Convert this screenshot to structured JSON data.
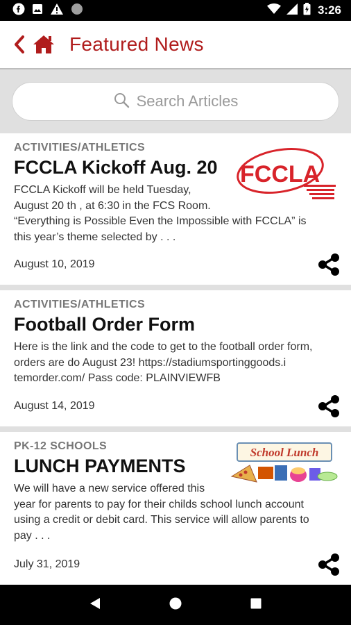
{
  "status_bar": {
    "time": "3:26",
    "left_icons": [
      "fb-icon",
      "image-icon",
      "warning-icon",
      "circle-icon"
    ],
    "right_icons": [
      "signal-icon",
      "wifi-icon",
      "battery-icon"
    ]
  },
  "app_bar": {
    "title": "Featured News",
    "accent_color": "#b01c1c"
  },
  "search": {
    "placeholder": "Search Articles"
  },
  "articles": [
    {
      "category": "ACTIVITIES/ATHLETICS",
      "headline": "FCCLA Kickoff Aug. 20",
      "excerpt": "FCCLA Kickoff will be held Tuesday,\nAugust 20 th , at 6:30 in the FCS Room.\n“Everything is Possible Even the Impossible with FCCLA” is\nthis year’s theme selected by . . .",
      "date": "August 10, 2019",
      "thumbnail_icon": "fccla-logo",
      "thumbnail_text": "FCCLA"
    },
    {
      "category": "ACTIVITIES/ATHLETICS",
      "headline": "Football Order Form",
      "excerpt": "Here is the link and the code to get to the football order form,\norders are do August 23! https://stadiumsportinggoods.i\ntemorder.com/ Pass code: PLAINVIEWFB",
      "date": "August 14, 2019"
    },
    {
      "category": "PK-12 SCHOOLS",
      "headline": "LUNCH PAYMENTS",
      "excerpt": " We will have a new service offered this\nyear for parents to pay for their childs school lunch account\nusing a credit or debit card.  This service will allow parents to\npay . . .",
      "date": "July 31, 2019",
      "thumbnail_icon": "school-lunch-image",
      "thumbnail_text": "School Lunch"
    }
  ]
}
